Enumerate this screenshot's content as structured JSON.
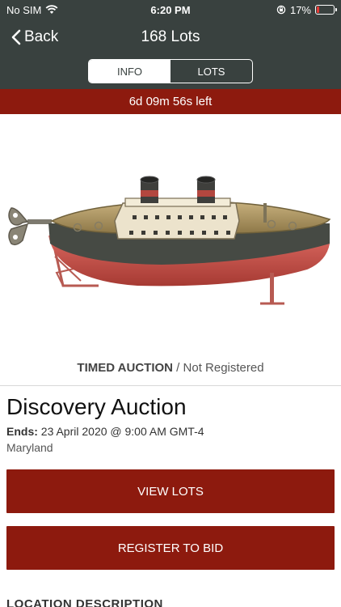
{
  "status_bar": {
    "carrier": "No SIM",
    "time": "6:20 PM",
    "battery_percent": "17%",
    "battery_level": 0.17,
    "icons": [
      "wifi-icon",
      "orientation-lock-icon",
      "battery-icon"
    ]
  },
  "nav": {
    "back_label": "Back",
    "title": "168 Lots"
  },
  "segments": {
    "info_label": "INFO",
    "lots_label": "LOTS",
    "selected": "INFO"
  },
  "timer": {
    "text": "6d 09m 56s left"
  },
  "auction": {
    "type": "TIMED AUCTION",
    "separator": " / ",
    "registration_status": "Not Registered",
    "title": "Discovery Auction",
    "ends_label": "Ends:",
    "ends_value": " 23 April 2020 @ 9:00 AM GMT-4",
    "location": "Maryland"
  },
  "buttons": {
    "view_lots": "VIEW LOTS",
    "register": "REGISTER TO BID"
  },
  "sections": {
    "location_description": "LOCATION DESCRIPTION"
  },
  "colors": {
    "header": "#39413f",
    "accent": "#8d1a0e",
    "battery_low": "#e53935"
  }
}
